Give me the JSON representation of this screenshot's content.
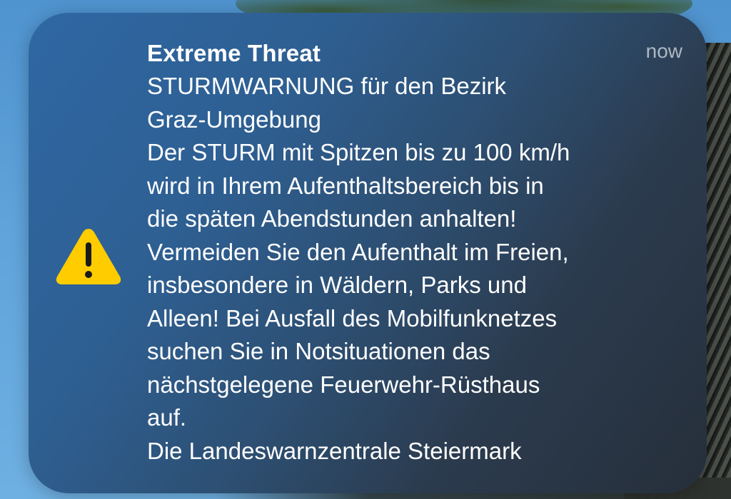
{
  "notification": {
    "title": "Extreme Threat",
    "time": "now",
    "icon": "warning-triangle-icon",
    "icon_color": "#FFCC00",
    "body_lines": [
      "STURMWARNUNG für den Bezirk",
      "Graz-Umgebung",
      "Der STURM mit Spitzen bis zu 100 km/h",
      "wird in Ihrem Aufenthaltsbereich bis in",
      "die späten Abendstunden anhalten!",
      "Vermeiden Sie den Aufenthalt im Freien,",
      "insbesondere in Wäldern, Parks und",
      "Alleen! Bei Ausfall des Mobilfunknetzes",
      "suchen Sie in Notsituationen das",
      "nächstgelegene Feuerwehr-Rüsthaus",
      "auf.",
      "Die Landeswarnzentrale Steiermark"
    ]
  }
}
